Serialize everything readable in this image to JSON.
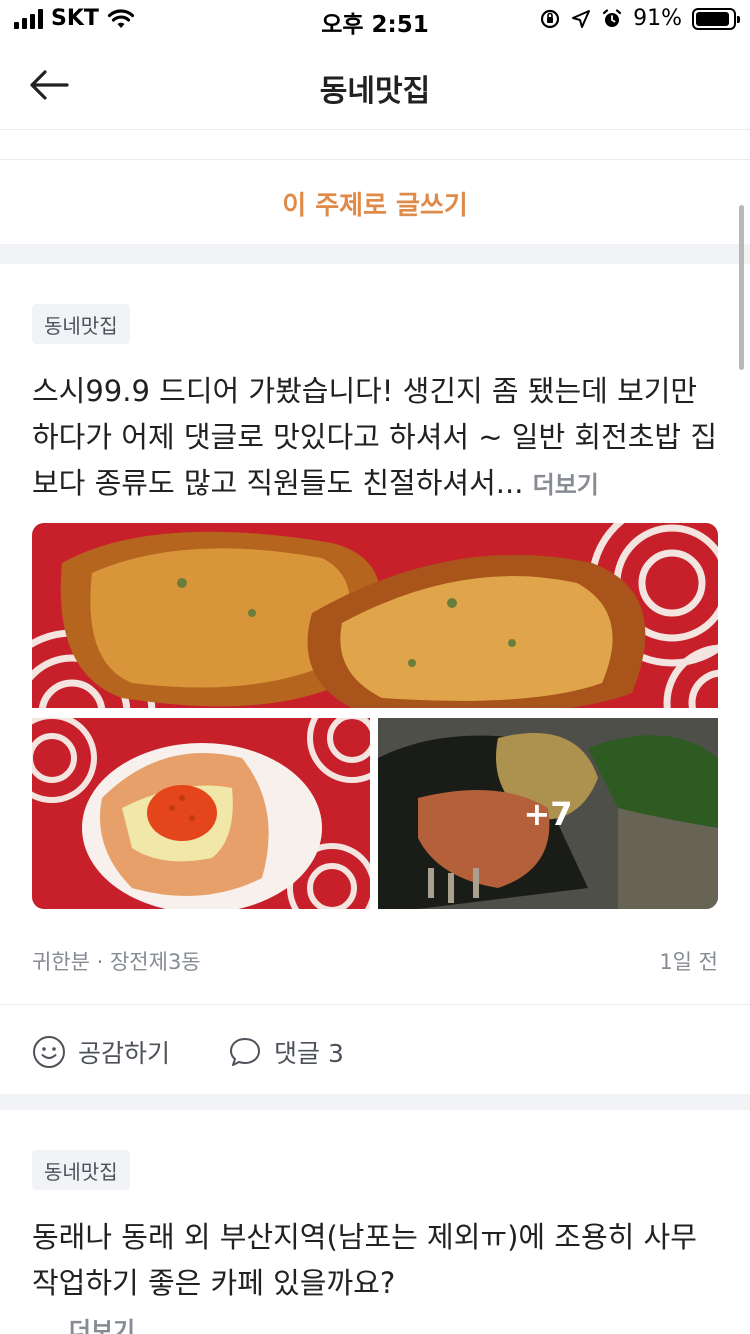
{
  "status_bar": {
    "carrier": "SKT",
    "time": "오후 2:51",
    "battery_percent": "91%",
    "battery_level": 0.91
  },
  "nav": {
    "title": "동네맛집"
  },
  "write_button": "이 주제로 글쓰기",
  "posts": [
    {
      "topic": "동네맛집",
      "body": "스시99.9 드디어 가봤습니다! 생긴지 좀 됐는데 보기만 하다가 어제 댓글로 맛있다고 하셔서 ~ 일반 회전초밥 집 보다 종류도 많고 직원들도 친절하셔서...",
      "more": "더보기",
      "extra_photos": "+7",
      "author_location": "귀한분 · 장전제3동",
      "time_ago": "1일 전",
      "like_label": "공감하기",
      "comment_label": "댓글 3"
    },
    {
      "topic": "동네맛집",
      "body": "동래나 동래 외 부산지역(남포는 제외ㅠ)에 조용히 사무 작업하기 좋은 카페 있을까요?",
      "ellipsis": "...",
      "more": "더보기"
    }
  ],
  "colors": {
    "accent": "#e08a4a",
    "muted": "#868b94",
    "divider": "#e9ecef",
    "gap": "#f2f3f6"
  }
}
